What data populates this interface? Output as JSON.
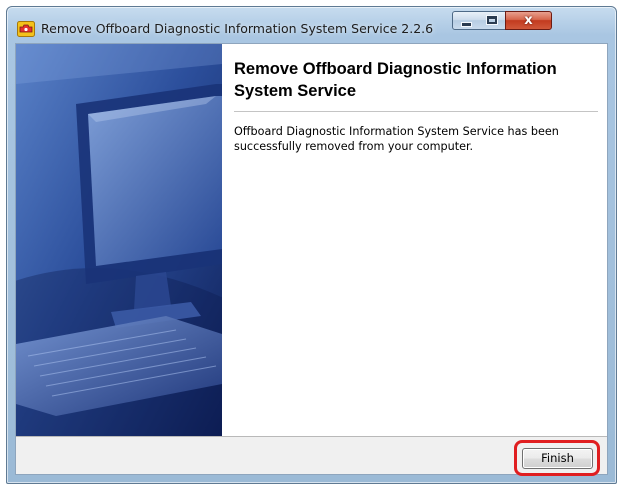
{
  "window": {
    "title": "Remove Offboard Diagnostic Information System Service 2.2.6",
    "controls": {
      "minimize_icon": "minimize-icon",
      "maximize_icon": "maximize-icon",
      "close_icon": "close-icon",
      "close_glyph": "x"
    }
  },
  "sidebar": {
    "image": "computer-monitor-keyboard-illustration"
  },
  "main": {
    "heading": "Remove Offboard Diagnostic Information System Service",
    "message": "Offboard Diagnostic Information System Service has been successfully removed from your computer."
  },
  "footer": {
    "finish_label": "Finish",
    "highlight_color": "#e01e20"
  },
  "colors": {
    "title_bar": "#a9c6e2",
    "close_button": "#c23a1f",
    "content_bg": "#ffffff",
    "footer_bg": "#f0f0f0"
  }
}
